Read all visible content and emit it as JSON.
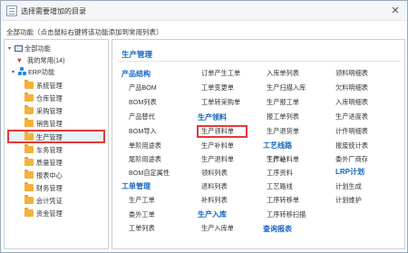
{
  "window": {
    "title": "选择需要增加的目录",
    "close_label": "✕"
  },
  "hint": "全部功能（点击鼠标右键将该功能添加到常用列表）",
  "tree": {
    "root": "全部功能",
    "favorites": "我的常用(14)",
    "erp": "ERP功能",
    "folders": [
      "系统管理",
      "仓库管理",
      "采购管理",
      "销售管理",
      "生产管理",
      "车务管理",
      "质量管理",
      "报表中心",
      "财务管理",
      "会计凭证",
      "资金管理"
    ],
    "selected": "生产管理"
  },
  "content": {
    "title": "生产管理",
    "sections": {
      "product": "产品结构",
      "prod_pick": "生产领料",
      "work_order": "工单管理",
      "prod_stock_in": "生产入库",
      "process": "工艺线路",
      "lrp": "LRP计划",
      "query": "查询报表"
    },
    "col1": {
      "product": [
        "产品BOM",
        "BOM列表",
        "产品替代",
        "BOM导入",
        "单阶用途表",
        "尾阶用途表",
        "BOM自定属性"
      ],
      "work_order": [
        "生产工单",
        "委外工单",
        "工单列表"
      ]
    },
    "col2": {
      "top": [
        "订单产生工单",
        "工单变更单",
        "工单转采购单"
      ],
      "prod_pick": [
        "生产领料单",
        "生产补料单",
        "生产退料单",
        "领料列表",
        "退料列表",
        "补料列表"
      ],
      "prod_stock_in": [
        "生产入库单"
      ]
    },
    "col3": {
      "top": [
        "入库单列表",
        "生产扫描入库",
        "生产报工单",
        "报工单列表",
        "生产退货单",
        "生产补料单"
      ],
      "process": [
        "工作站",
        "工序资料",
        "工艺路线",
        "工序转移单",
        "工序转移扫描"
      ],
      "query_header": "查询报表"
    },
    "col4": {
      "top": [
        "领料明细表",
        "欠料明细表",
        "入库明细表",
        "生产进度表",
        "计件明细表",
        "报废统计表",
        "委外厂商存"
      ],
      "lrp": [
        "计划生成",
        "计划维护"
      ]
    },
    "highlighted_item": "生产领料单"
  },
  "colors": {
    "accent_blue": "#1565c0",
    "highlight_red": "#e53935",
    "folder": "#f3b23a"
  }
}
